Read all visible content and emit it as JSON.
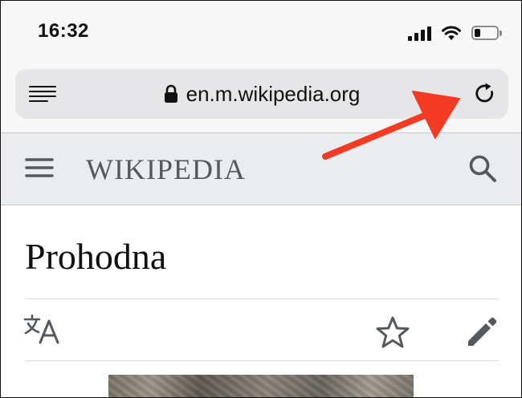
{
  "status_bar": {
    "time": "16:32",
    "icons": [
      "cellular-signal-icon",
      "wifi-icon",
      "battery-icon"
    ],
    "battery_level_fraction": 0.25
  },
  "address_bar": {
    "url": "en.m.wikipedia.org",
    "icons": [
      "reader-view-icon",
      "lock-icon",
      "reload-icon"
    ]
  },
  "wiki_header": {
    "wordmark": "WIKIPEDIA",
    "icons": [
      "hamburger-menu-icon",
      "search-icon"
    ],
    "background": "#eaecf0"
  },
  "article": {
    "title": "Prohodna",
    "actions": [
      "language-icon",
      "watch-star-icon",
      "edit-pencil-icon"
    ]
  },
  "annotation": {
    "color": "#f33a22",
    "icon": "red-arrow-pointing-at-reload"
  }
}
